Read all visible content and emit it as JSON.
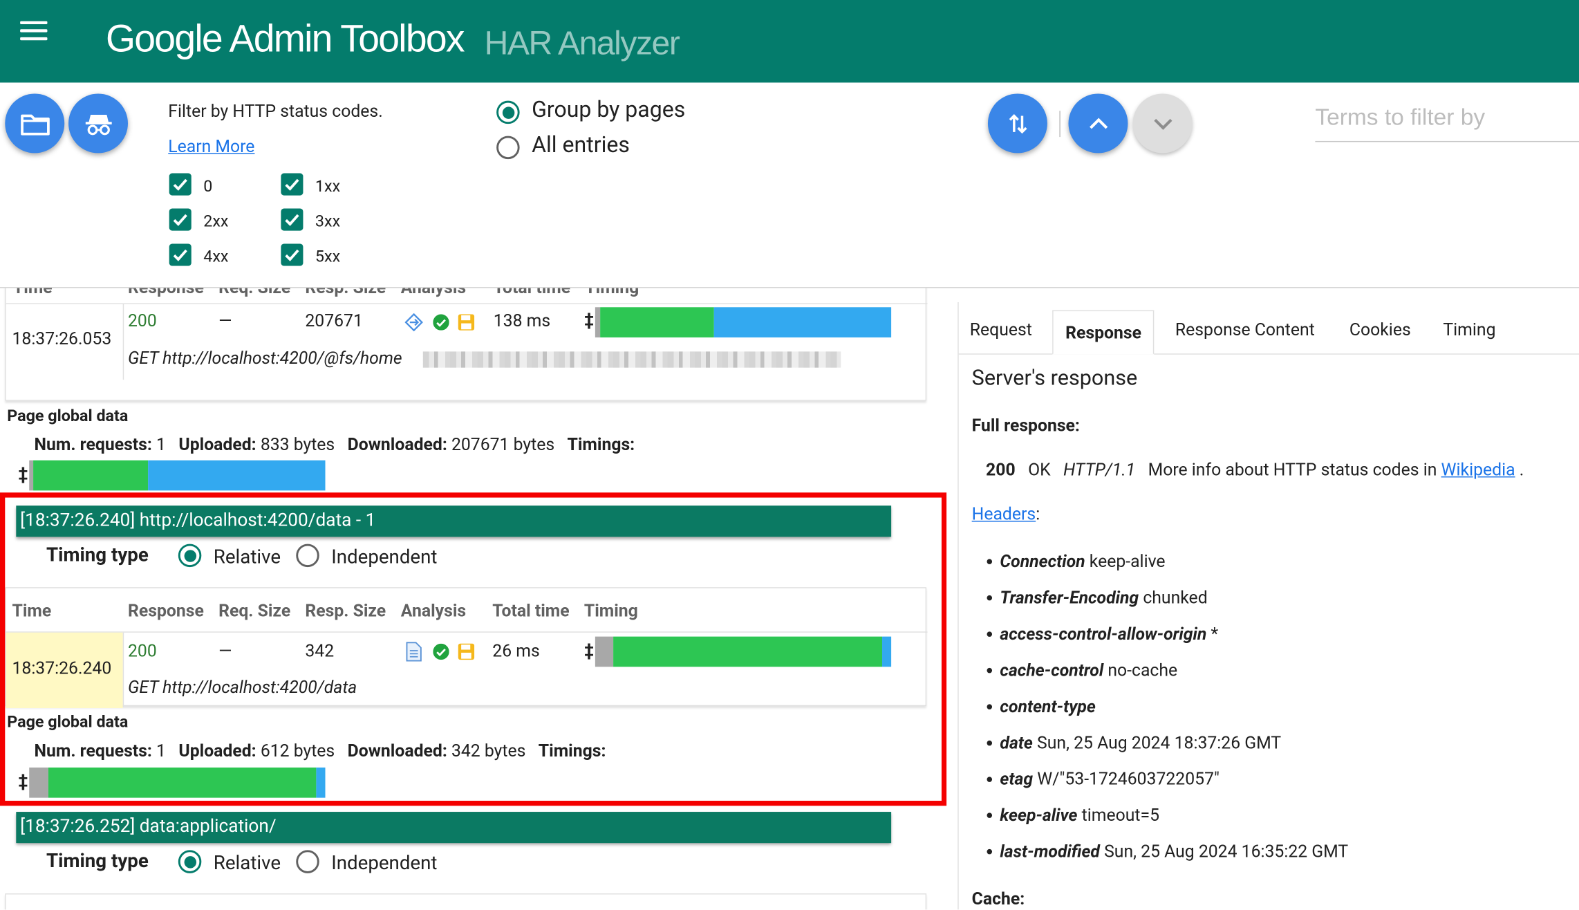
{
  "header": {
    "brand": "Google Admin Toolbox",
    "subtitle": "HAR Analyzer"
  },
  "toolbar": {
    "filter_title": "Filter by HTTP status codes.",
    "learn_more": "Learn More",
    "checkboxes": [
      {
        "label": "0",
        "checked": true
      },
      {
        "label": "1xx",
        "checked": true
      },
      {
        "label": "2xx",
        "checked": true
      },
      {
        "label": "3xx",
        "checked": true
      },
      {
        "label": "4xx",
        "checked": true
      },
      {
        "label": "5xx",
        "checked": true
      }
    ],
    "group_options": [
      "Group by pages",
      "All entries"
    ],
    "group_selected": "Group by pages",
    "search_placeholder": "Terms to filter by"
  },
  "table_headers": [
    "Time",
    "Response",
    "Req. Size",
    "Resp. Size",
    "Analysis",
    "Total time",
    "Timing"
  ],
  "pages": [
    {
      "entry": {
        "time": "18:37:26.053",
        "status": "200",
        "req_size": "—",
        "resp_size": "207671",
        "total_time": "138 ms",
        "url": "GET http://localhost:4200/@fs/home"
      },
      "global": {
        "title": "Page global data",
        "num_requests_label": "Num. requests:",
        "num_requests": "1",
        "uploaded_label": "Uploaded:",
        "uploaded": "833 bytes",
        "downloaded_label": "Downloaded:",
        "downloaded": "207671 bytes",
        "timings_label": "Timings:"
      }
    },
    {
      "title": "[18:37:26.240] http://localhost:4200/data - 1",
      "timing_type_label": "Timing type",
      "timing_options": [
        "Relative",
        "Independent"
      ],
      "timing_selected": "Relative",
      "entry": {
        "time": "18:37:26.240",
        "status": "200",
        "req_size": "—",
        "resp_size": "342",
        "total_time": "26 ms",
        "url": "GET http://localhost:4200/data"
      },
      "global": {
        "title": "Page global data",
        "num_requests_label": "Num. requests:",
        "num_requests": "1",
        "uploaded_label": "Uploaded:",
        "uploaded": "612 bytes",
        "downloaded_label": "Downloaded:",
        "downloaded": "342 bytes",
        "timings_label": "Timings:"
      }
    },
    {
      "title": "[18:37:26.252] data:application/",
      "timing_type_label": "Timing type",
      "timing_options": [
        "Relative",
        "Independent"
      ],
      "timing_selected": "Relative"
    }
  ],
  "details": {
    "tabs": [
      "Request",
      "Response",
      "Response Content",
      "Cookies",
      "Timing"
    ],
    "active_tab": "Response",
    "title": "Server's response",
    "full_response_label": "Full response:",
    "status_code": "200",
    "status_text": "OK",
    "protocol": "HTTP/1.1",
    "more_info": "More info about HTTP status codes in",
    "wikipedia": "Wikipedia",
    "period": ".",
    "headers_link": "Headers",
    "headers_colon": ":",
    "headers": [
      {
        "key": "Connection",
        "value": "keep-alive"
      },
      {
        "key": "Transfer-Encoding",
        "value": "chunked"
      },
      {
        "key": "access-control-allow-origin",
        "value": "*"
      },
      {
        "key": "cache-control",
        "value": "no-cache"
      },
      {
        "key": "content-type",
        "value": ""
      },
      {
        "key": "date",
        "value": "Sun, 25 Aug 2024 18:37:26 GMT"
      },
      {
        "key": "etag",
        "value": "W/\"53-1724603722057\""
      },
      {
        "key": "keep-alive",
        "value": "timeout=5"
      },
      {
        "key": "last-modified",
        "value": "Sun, 25 Aug 2024 16:35:22 GMT"
      }
    ],
    "cache_label": "Cache:"
  },
  "colors": {
    "header_bg": "#047c6c",
    "fab_blue": "#3a86e8",
    "timing_green": "#2dc653",
    "timing_blue": "#33a9f0",
    "timing_gray": "#a8a8a8",
    "highlight_border": "#f40000",
    "page_bar": "#0b7a63"
  },
  "icons": [
    "menu-icon",
    "folder-icon",
    "incognito-icon",
    "sort-icon",
    "chevron-up-icon",
    "chevron-down-icon",
    "diamond-arrows-icon",
    "document-icon",
    "check-circle-icon",
    "save-disk-icon"
  ]
}
